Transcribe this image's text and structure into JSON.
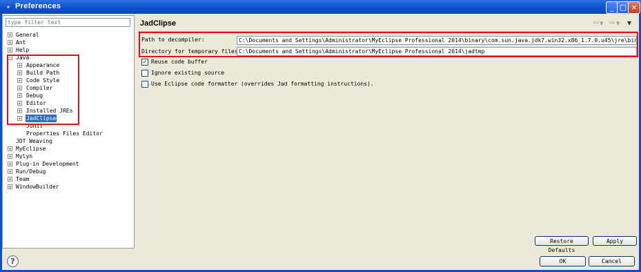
{
  "window": {
    "title": "Preferences",
    "controls": {
      "minimize": "_",
      "maximize": "□",
      "close": "×"
    }
  },
  "filter": {
    "placeholder": "type filter text"
  },
  "tree": {
    "general": "General",
    "ant": "Ant",
    "help": "Help",
    "java": "Java",
    "java_children": {
      "appearance": "Appearance",
      "build_path": "Build Path",
      "code_style": "Code Style",
      "compiler": "Compiler",
      "debug": "Debug",
      "editor": "Editor",
      "installed_jres": "Installed JREs",
      "jadclipse": "JadClipse",
      "junit": "JUnit",
      "properties_files_editor": "Properties Files Editor"
    },
    "jdt_weaving": "JDT Weaving",
    "myeclipse": "MyEclipse",
    "mylyn": "Mylyn",
    "plugin_development": "Plug-in Development",
    "run_debug": "Run/Debug",
    "team": "Team",
    "windowbuilder": "WindowBuilder"
  },
  "page": {
    "title": "JadClipse",
    "path_label": "Path to decompiler:",
    "path_value": "C:\\Documents and Settings\\Administrator\\MyEclipse Professional 2014\\binary\\com.sun.java.jdk7.win32.x86_1.7.0.u45\\jre\\bin\\jad.exe",
    "temp_label": "Directory for temporary files:",
    "temp_value": "C:\\Documents and Settings\\Administrator\\MyEclipse Professional 2014\\jadtmp",
    "reuse_label": "Reuse code buffer",
    "reuse_checked": true,
    "ignore_label": "Ignore existing source",
    "ignore_checked": false,
    "formatter_label": "Use Eclipse code formatter (overrides Jad formatting instructions).",
    "formatter_checked": false
  },
  "buttons": {
    "restore_defaults": "Restore Defaults",
    "apply": "Apply",
    "ok": "OK",
    "cancel": "Cancel"
  },
  "icons": {
    "back": "⇦",
    "forward": "⇨",
    "menu": "▼",
    "help": "?",
    "expand": "+",
    "collapse": "−",
    "check": "✔"
  },
  "colors": {
    "titlebar": "#0a4fd0",
    "selection": "#316ac5",
    "highlight_box": "#e0101a"
  }
}
